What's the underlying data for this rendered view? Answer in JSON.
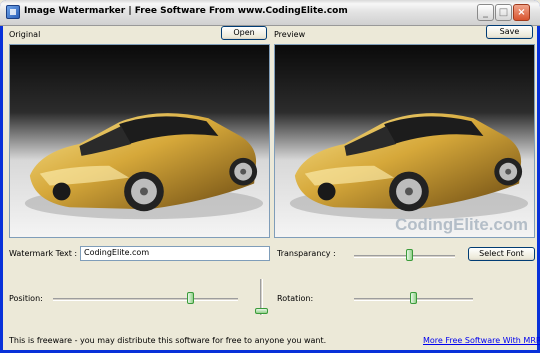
{
  "window": {
    "title": "Image Watermarker  |  Free Software From www.CodingElite.com"
  },
  "original": {
    "label": "Original",
    "open_button": "Open"
  },
  "preview": {
    "label": "Preview",
    "save_button": "Save",
    "watermark_overlay": "CodingElite.com"
  },
  "watermark_text": {
    "label": "Watermark Text :",
    "value": "CodingElite.com"
  },
  "transparency": {
    "label": "Transparancy :",
    "value_fraction": 0.55
  },
  "font_button": "Select Font",
  "position": {
    "label": "Position:",
    "horizontal_fraction": 0.75,
    "vertical_fraction": 0.95
  },
  "rotation": {
    "label": "Rotation:",
    "value_fraction": 0.5
  },
  "footer": {
    "freeware_text": "This is freeware - you may distribute this software for free to anyone you want.",
    "more_link": "More Free Software With MRR"
  },
  "colors": {
    "title_gradient": "#d9d9d9",
    "window_bg": "#ece9d8",
    "link": "#0000ee",
    "watermark_text_color": "#b4bec8"
  }
}
